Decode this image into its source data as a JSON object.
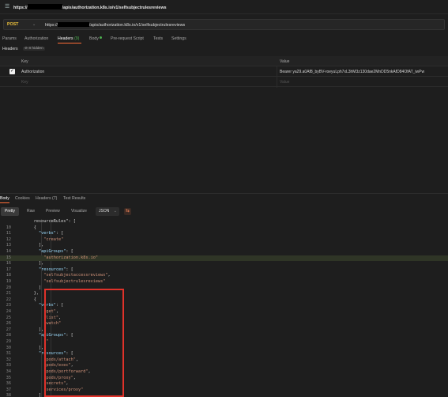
{
  "titlebar": {
    "url_prefix": "https://",
    "url_suffix": "/apis/authorization.k8s.io/v1/selfsubjectrulesreviews"
  },
  "request": {
    "method": "POST",
    "url_prefix": "https://",
    "url_suffix": "/apis/authorization.k8s.io/v1/selfsubjectrulesreviews"
  },
  "req_tabs": [
    {
      "label": "Params"
    },
    {
      "label": "Authorization"
    },
    {
      "label": "Headers",
      "count": "(9)"
    },
    {
      "label": "Body"
    },
    {
      "label": "Pre-request Script"
    },
    {
      "label": "Tests"
    },
    {
      "label": "Settings"
    }
  ],
  "headers_section": {
    "label": "Headers",
    "hidden_badge": "8 hidden"
  },
  "headers_table": {
    "col_key": "Key",
    "col_value": "Value",
    "rows": [
      {
        "key": "Authorization",
        "value": "Bearer ya29.a0Af8_byBV-roeyuLph7xL3hM3z130dae2MnDD5nkAfD84OfAT_iwPw"
      }
    ],
    "placeholder_key": "Key",
    "placeholder_value": "Value"
  },
  "resp_tabs": [
    {
      "label": "Body"
    },
    {
      "label": "Cookies"
    },
    {
      "label": "Headers (7)"
    },
    {
      "label": "Test Results"
    }
  ],
  "view_modes": [
    "Pretty",
    "Raw",
    "Preview",
    "Visualize"
  ],
  "format": "JSON",
  "code_lines": [
    {
      "n": "",
      "t": "      resourceRules\": ["
    },
    {
      "n": "10",
      "t": "      {"
    },
    {
      "n": "11",
      "t": "        \"verbs\": ["
    },
    {
      "n": "12",
      "t": "          \"create\""
    },
    {
      "n": "13",
      "t": "        ],"
    },
    {
      "n": "14",
      "t": "        \"apiGroups\": ["
    },
    {
      "n": "15",
      "t": "          \"authorization.k8s.io\"",
      "hl": true
    },
    {
      "n": "16",
      "t": "        ],"
    },
    {
      "n": "17",
      "t": "        \"resources\": ["
    },
    {
      "n": "18",
      "t": "          \"selfsubjectaccessreviews\","
    },
    {
      "n": "19",
      "t": "          \"selfsubjectrulesreviews\""
    },
    {
      "n": "20",
      "t": "        ]"
    },
    {
      "n": "21",
      "t": "      },"
    },
    {
      "n": "22",
      "t": "      {"
    },
    {
      "n": "23",
      "t": "        \"verbs\": ["
    },
    {
      "n": "24",
      "t": "          \"get\","
    },
    {
      "n": "25",
      "t": "          \"list\","
    },
    {
      "n": "26",
      "t": "          \"watch\""
    },
    {
      "n": "27",
      "t": "        ],"
    },
    {
      "n": "28",
      "t": "        \"apiGroups\": ["
    },
    {
      "n": "29",
      "t": "          \"\""
    },
    {
      "n": "30",
      "t": "        ],"
    },
    {
      "n": "31",
      "t": "        \"resources\": ["
    },
    {
      "n": "32",
      "t": "          \"pods/attach\","
    },
    {
      "n": "33",
      "t": "          \"pods/exec\","
    },
    {
      "n": "34",
      "t": "          \"pods/portforward\","
    },
    {
      "n": "35",
      "t": "          \"pods/proxy\","
    },
    {
      "n": "36",
      "t": "          \"secrets\","
    },
    {
      "n": "37",
      "t": "          \"services/proxy\""
    },
    {
      "n": "38",
      "t": "        ]"
    }
  ],
  "colors": {
    "accent": "#ff6c37",
    "method": "#f0c33c",
    "highlight_box": "#e0322a"
  }
}
